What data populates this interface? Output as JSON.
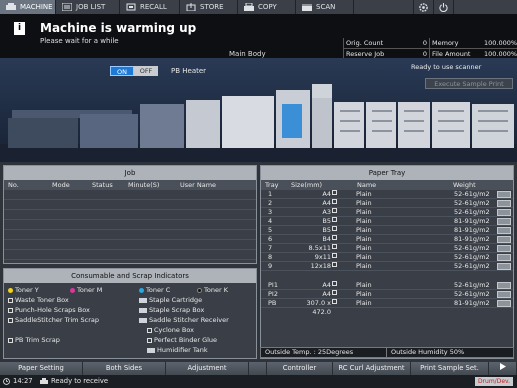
{
  "tabs": [
    {
      "label": "MACHINE",
      "icon": "machine-icon",
      "active": true
    },
    {
      "label": "JOB LIST",
      "icon": "job-list-icon",
      "active": false
    },
    {
      "label": "RECALL",
      "icon": "recall-icon",
      "active": false
    },
    {
      "label": "STORE",
      "icon": "store-icon",
      "active": false
    },
    {
      "label": "COPY",
      "icon": "copy-icon",
      "active": false
    },
    {
      "label": "SCAN",
      "icon": "scan-icon",
      "active": false
    }
  ],
  "message": {
    "title": "Machine is warming up",
    "subtitle": "Please wait for a while",
    "main_body": "Main Body"
  },
  "counters": {
    "orig_count_label": "Orig. Count",
    "orig_count": "0",
    "memory_label": "Memory",
    "memory": "100.000%",
    "reserve_job_label": "Reserve Job",
    "reserve_job": "0",
    "file_amount_label": "File Amount",
    "file_amount": "100.000%"
  },
  "machine": {
    "on_label": "ON",
    "off_label": "OFF",
    "pb_heater": "PB Heater",
    "ready_scanner": "Ready to use scanner",
    "execute_sample": "Execute Sample Print"
  },
  "job": {
    "title": "Job",
    "columns": [
      "No.",
      "Mode",
      "Status",
      "Minute(S)",
      "User Name"
    ]
  },
  "consumables": {
    "title": "Consumable and Scrap Indicators",
    "toner_y": "Toner Y",
    "toner_m": "Toner M",
    "toner_c": "Toner C",
    "toner_k": "Toner K",
    "waste_toner": "Waste Toner Box",
    "staple_cartridge": "Staple Cartridge",
    "punch_hole": "Punch-Hole Scraps Box",
    "staple_scrap": "Staple Scrap Box",
    "saddle_trim": "SaddleStitcher Trim Scrap",
    "saddle_receiver": "Saddle Stitcher Receiver",
    "cyclone": "Cyclone Box",
    "pb_trim": "PB Trim Scrap",
    "binder_glue": "Perfect Binder Glue",
    "humidifier": "Humidifier Tank",
    "colors": {
      "yellow": "#f1d21c",
      "magenta": "#d8389a",
      "cyan": "#2aa6e0",
      "black": "#111111"
    }
  },
  "paper_tray": {
    "title": "Paper Tray",
    "columns": {
      "tray": "Tray",
      "size": "Size(mm)",
      "name": "Name",
      "weight": "Weight"
    },
    "rows": [
      {
        "tray": "1",
        "size": "A4",
        "name": "Plain",
        "weight": "52-61g/m2"
      },
      {
        "tray": "2",
        "size": "A4",
        "name": "Plain",
        "weight": "52-61g/m2"
      },
      {
        "tray": "3",
        "size": "A3",
        "name": "Plain",
        "weight": "52-61g/m2"
      },
      {
        "tray": "4",
        "size": "B5",
        "name": "Plain",
        "weight": "81-91g/m2"
      },
      {
        "tray": "5",
        "size": "B5",
        "name": "Plain",
        "weight": "81-91g/m2"
      },
      {
        "tray": "6",
        "size": "B4",
        "name": "Plain",
        "weight": "81-91g/m2"
      },
      {
        "tray": "7",
        "size": "8.5x11",
        "name": "Plain",
        "weight": "52-61g/m2"
      },
      {
        "tray": "8",
        "size": "9x11",
        "name": "Plain",
        "weight": "52-61g/m2"
      },
      {
        "tray": "9",
        "size": "12x18",
        "name": "Plain",
        "weight": "52-61g/m2"
      },
      {
        "tray": "PI1",
        "size": "A4",
        "name": "Plain",
        "weight": "52-61g/m2"
      },
      {
        "tray": "PI2",
        "size": "A4",
        "name": "Plain",
        "weight": "52-61g/m2"
      },
      {
        "tray": "PB",
        "size": "307.0 x 472.0",
        "name": "Plain",
        "weight": "81-91g/m2"
      }
    ],
    "outside_temp": "Outside Temp.     : 25Degrees",
    "outside_humidity": "Outside Humidity   50%"
  },
  "bottom_buttons": [
    "Paper Setting",
    "Both Sides",
    "Adjustment",
    "Controller",
    "RC Curl Adjustment",
    "Print Sample Set."
  ],
  "status": {
    "time": "14:27",
    "message": "Ready to receive",
    "drum": "Drum/Dev."
  }
}
